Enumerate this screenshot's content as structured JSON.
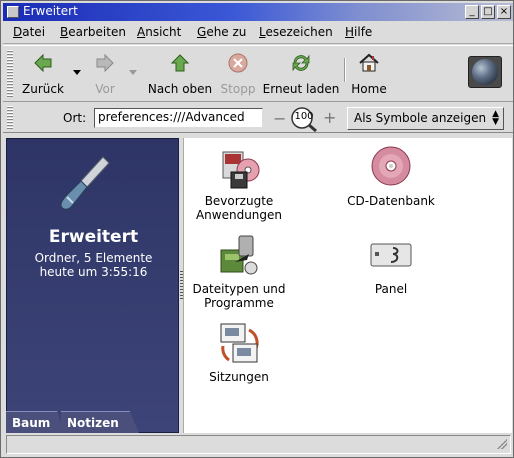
{
  "window": {
    "title": "Erweitert"
  },
  "menubar": {
    "items": [
      "Datei",
      "Bearbeiten",
      "Ansicht",
      "Gehe zu",
      "Lesezeichen",
      "Hilfe"
    ]
  },
  "toolbar": {
    "back": "Zurück",
    "forward": "Vor",
    "up": "Nach oben",
    "stop": "Stopp",
    "reload": "Erneut laden",
    "home": "Home"
  },
  "location": {
    "label": "Ort:",
    "value": "preferences:///Advanced",
    "zoom": "100",
    "view_mode": "Als Symbole anzeigen"
  },
  "sidebar": {
    "title": "Erweitert",
    "info_line1": "Ordner, 5 Elemente",
    "info_line2": "heute um 3:55:16",
    "tabs": [
      "Baum",
      "Notizen"
    ]
  },
  "items": [
    {
      "label_line1": "Bevorzugte",
      "label_line2": "Anwendungen",
      "icon": "preferred-apps-icon"
    },
    {
      "label_line1": "CD-Datenbank",
      "label_line2": "",
      "icon": "cd-database-icon"
    },
    {
      "label_line1": "Dateitypen und",
      "label_line2": "Programme",
      "icon": "file-types-icon"
    },
    {
      "label_line1": "Panel",
      "label_line2": "",
      "icon": "panel-icon"
    },
    {
      "label_line1": "Sitzungen",
      "label_line2": "",
      "icon": "sessions-icon"
    }
  ],
  "colors": {
    "title_gradient_start": "#1a2bb5",
    "sidebar_bg": "#2e3566",
    "content_bg": "#ffffff"
  }
}
